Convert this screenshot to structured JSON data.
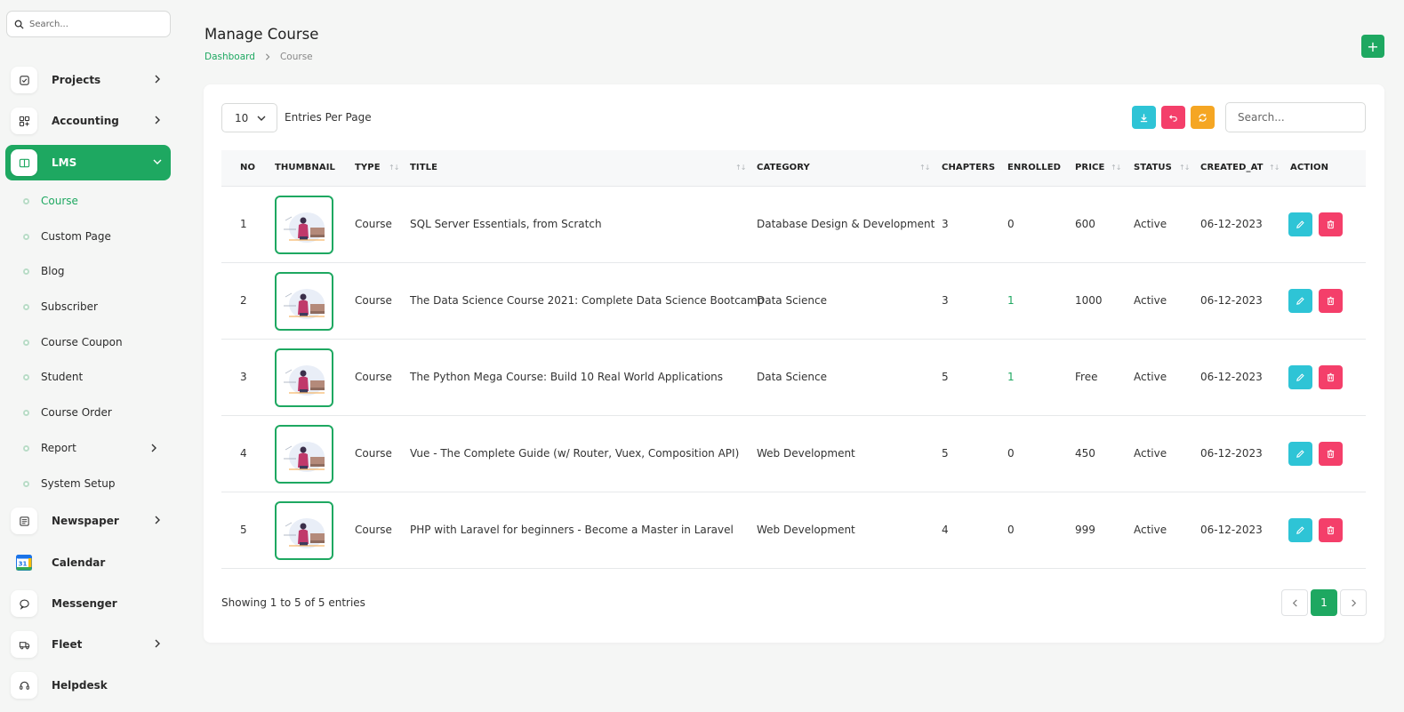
{
  "sidebar": {
    "search_placeholder": "Search...",
    "items": [
      {
        "label": "Projects",
        "icon": "checkbox-icon",
        "has_children": true
      },
      {
        "label": "Accounting",
        "icon": "grid-plus-icon",
        "has_children": true
      },
      {
        "label": "LMS",
        "icon": "book-icon",
        "has_children": true,
        "active": true
      }
    ],
    "lms_subitems": [
      {
        "label": "Course",
        "current": true
      },
      {
        "label": "Custom Page"
      },
      {
        "label": "Blog"
      },
      {
        "label": "Subscriber"
      },
      {
        "label": "Course Coupon"
      },
      {
        "label": "Student"
      },
      {
        "label": "Course Order"
      },
      {
        "label": "Report",
        "has_children": true
      },
      {
        "label": "System Setup"
      }
    ],
    "bottom_items": [
      {
        "label": "Newspaper",
        "icon": "newspaper-icon",
        "has_children": true
      },
      {
        "label": "Calendar",
        "icon": "calendar-icon",
        "calendar_day": "31"
      },
      {
        "label": "Messenger",
        "icon": "chat-icon"
      },
      {
        "label": "Fleet",
        "icon": "truck-icon",
        "has_children": true
      },
      {
        "label": "Helpdesk",
        "icon": "headset-icon"
      }
    ]
  },
  "header": {
    "title": "Manage Course",
    "breadcrumb": [
      "Dashboard",
      "Course"
    ],
    "add_label": "+"
  },
  "controls": {
    "entries_value": "10",
    "entries_label": "Entries Per Page",
    "search_placeholder": "Search..."
  },
  "colors": {
    "primary": "#1ea861",
    "edit": "#2ec4d6",
    "delete": "#f43f6a",
    "refresh": "#f5a623"
  },
  "table": {
    "columns": [
      "NO",
      "THUMBNAIL",
      "TYPE",
      "TITLE",
      "CATEGORY",
      "CHAPTERS",
      "ENROLLED",
      "PRICE",
      "STATUS",
      "CREATED_AT",
      "ACTION"
    ],
    "rows": [
      {
        "no": "1",
        "type": "Course",
        "title": "SQL Server Essentials, from Scratch",
        "category": "Database Design & Development",
        "chapters": "3",
        "enrolled": "0",
        "price": "600",
        "status": "Active",
        "created_at": "06-12-2023"
      },
      {
        "no": "2",
        "type": "Course",
        "title": "The Data Science Course 2021: Complete Data Science Bootcamp",
        "category": "Data Science",
        "chapters": "3",
        "enrolled": "1",
        "price": "1000",
        "status": "Active",
        "created_at": "06-12-2023"
      },
      {
        "no": "3",
        "type": "Course",
        "title": "The Python Mega Course: Build 10 Real World Applications",
        "category": "Data Science",
        "chapters": "5",
        "enrolled": "1",
        "price": "Free",
        "status": "Active",
        "created_at": "06-12-2023"
      },
      {
        "no": "4",
        "type": "Course",
        "title": "Vue - The Complete Guide (w/ Router, Vuex, Composition API)",
        "category": "Web Development",
        "chapters": "5",
        "enrolled": "0",
        "price": "450",
        "status": "Active",
        "created_at": "06-12-2023"
      },
      {
        "no": "5",
        "type": "Course",
        "title": "PHP with Laravel for beginners - Become a Master in Laravel",
        "category": "Web Development",
        "chapters": "4",
        "enrolled": "0",
        "price": "999",
        "status": "Active",
        "created_at": "06-12-2023"
      }
    ]
  },
  "footer": {
    "showing": "Showing 1 to 5 of 5 entries",
    "current_page": "1"
  }
}
